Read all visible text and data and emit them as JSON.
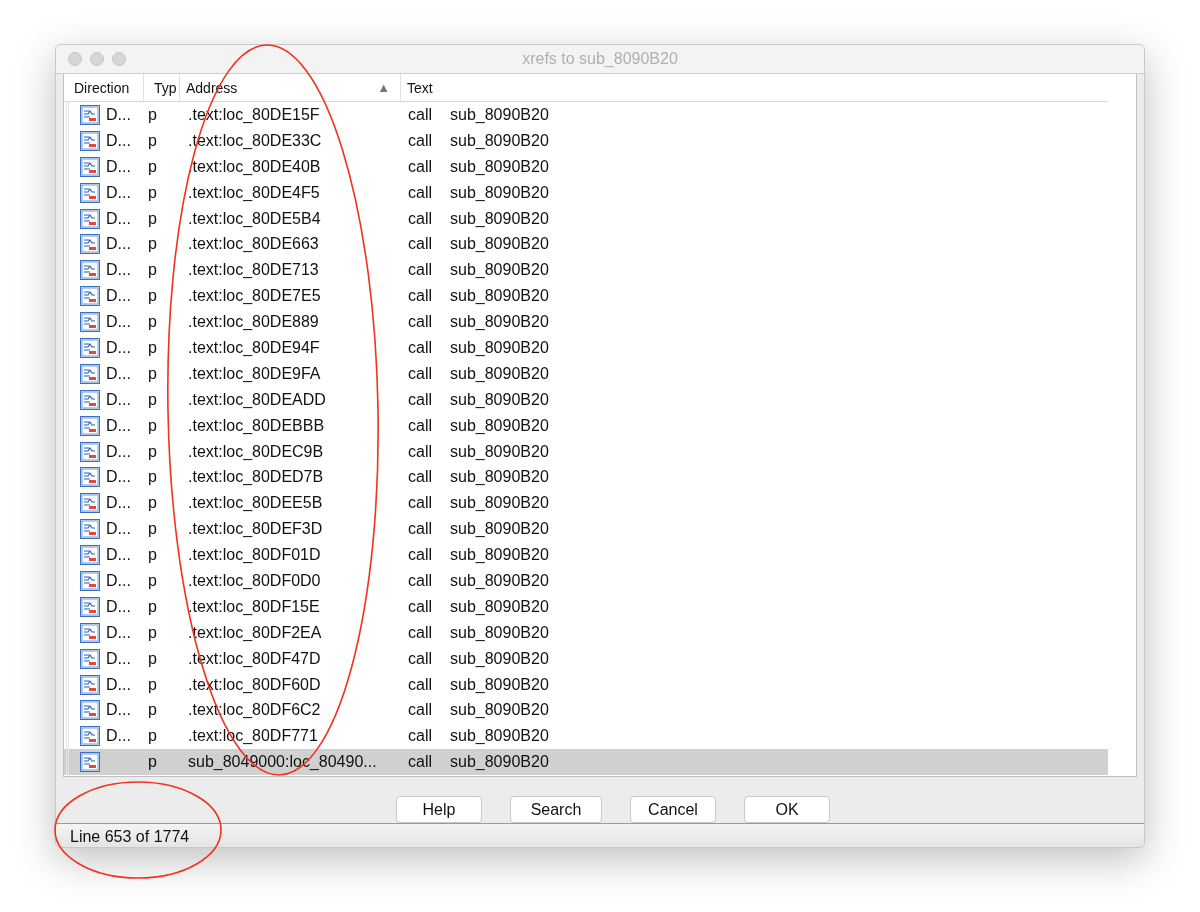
{
  "window": {
    "title": "xrefs to sub_8090B20"
  },
  "table": {
    "columns": [
      {
        "label": "Direction"
      },
      {
        "label": "Typ"
      },
      {
        "label": "Address",
        "sort_indicator": "▲"
      },
      {
        "label": "Text"
      }
    ],
    "rows": [
      {
        "direction": "D...",
        "type": "p",
        "address": ".text:loc_80DE15F",
        "mnemonic": "call",
        "operand": "sub_8090B20",
        "selected": false
      },
      {
        "direction": "D...",
        "type": "p",
        "address": ".text:loc_80DE33C",
        "mnemonic": "call",
        "operand": "sub_8090B20",
        "selected": false
      },
      {
        "direction": "D...",
        "type": "p",
        "address": ".text:loc_80DE40B",
        "mnemonic": "call",
        "operand": "sub_8090B20",
        "selected": false
      },
      {
        "direction": "D...",
        "type": "p",
        "address": ".text:loc_80DE4F5",
        "mnemonic": "call",
        "operand": "sub_8090B20",
        "selected": false
      },
      {
        "direction": "D...",
        "type": "p",
        "address": ".text:loc_80DE5B4",
        "mnemonic": "call",
        "operand": "sub_8090B20",
        "selected": false
      },
      {
        "direction": "D...",
        "type": "p",
        "address": ".text:loc_80DE663",
        "mnemonic": "call",
        "operand": "sub_8090B20",
        "selected": false
      },
      {
        "direction": "D...",
        "type": "p",
        "address": ".text:loc_80DE713",
        "mnemonic": "call",
        "operand": "sub_8090B20",
        "selected": false
      },
      {
        "direction": "D...",
        "type": "p",
        "address": ".text:loc_80DE7E5",
        "mnemonic": "call",
        "operand": "sub_8090B20",
        "selected": false
      },
      {
        "direction": "D...",
        "type": "p",
        "address": ".text:loc_80DE889",
        "mnemonic": "call",
        "operand": "sub_8090B20",
        "selected": false
      },
      {
        "direction": "D...",
        "type": "p",
        "address": ".text:loc_80DE94F",
        "mnemonic": "call",
        "operand": "sub_8090B20",
        "selected": false
      },
      {
        "direction": "D...",
        "type": "p",
        "address": ".text:loc_80DE9FA",
        "mnemonic": "call",
        "operand": "sub_8090B20",
        "selected": false
      },
      {
        "direction": "D...",
        "type": "p",
        "address": ".text:loc_80DEADD",
        "mnemonic": "call",
        "operand": "sub_8090B20",
        "selected": false
      },
      {
        "direction": "D...",
        "type": "p",
        "address": ".text:loc_80DEBBB",
        "mnemonic": "call",
        "operand": "sub_8090B20",
        "selected": false
      },
      {
        "direction": "D...",
        "type": "p",
        "address": ".text:loc_80DEC9B",
        "mnemonic": "call",
        "operand": "sub_8090B20",
        "selected": false
      },
      {
        "direction": "D...",
        "type": "p",
        "address": ".text:loc_80DED7B",
        "mnemonic": "call",
        "operand": "sub_8090B20",
        "selected": false
      },
      {
        "direction": "D...",
        "type": "p",
        "address": ".text:loc_80DEE5B",
        "mnemonic": "call",
        "operand": "sub_8090B20",
        "selected": false
      },
      {
        "direction": "D...",
        "type": "p",
        "address": ".text:loc_80DEF3D",
        "mnemonic": "call",
        "operand": "sub_8090B20",
        "selected": false
      },
      {
        "direction": "D...",
        "type": "p",
        "address": ".text:loc_80DF01D",
        "mnemonic": "call",
        "operand": "sub_8090B20",
        "selected": false
      },
      {
        "direction": "D...",
        "type": "p",
        "address": ".text:loc_80DF0D0",
        "mnemonic": "call",
        "operand": "sub_8090B20",
        "selected": false
      },
      {
        "direction": "D...",
        "type": "p",
        "address": ".text:loc_80DF15E",
        "mnemonic": "call",
        "operand": "sub_8090B20",
        "selected": false
      },
      {
        "direction": "D...",
        "type": "p",
        "address": ".text:loc_80DF2EA",
        "mnemonic": "call",
        "operand": "sub_8090B20",
        "selected": false
      },
      {
        "direction": "D...",
        "type": "p",
        "address": ".text:loc_80DF47D",
        "mnemonic": "call",
        "operand": "sub_8090B20",
        "selected": false
      },
      {
        "direction": "D...",
        "type": "p",
        "address": ".text:loc_80DF60D",
        "mnemonic": "call",
        "operand": "sub_8090B20",
        "selected": false
      },
      {
        "direction": "D...",
        "type": "p",
        "address": ".text:loc_80DF6C2",
        "mnemonic": "call",
        "operand": "sub_8090B20",
        "selected": false
      },
      {
        "direction": "D...",
        "type": "p",
        "address": ".text:loc_80DF771",
        "mnemonic": "call",
        "operand": "sub_8090B20",
        "selected": false
      },
      {
        "type": "p",
        "address": "sub_8049000:loc_80490...",
        "mnemonic": "call",
        "operand": "sub_8090B20",
        "selected": true
      }
    ]
  },
  "buttons": [
    "Help",
    "Search",
    "Cancel",
    "OK"
  ],
  "status_bar": "Line 653 of 1774"
}
